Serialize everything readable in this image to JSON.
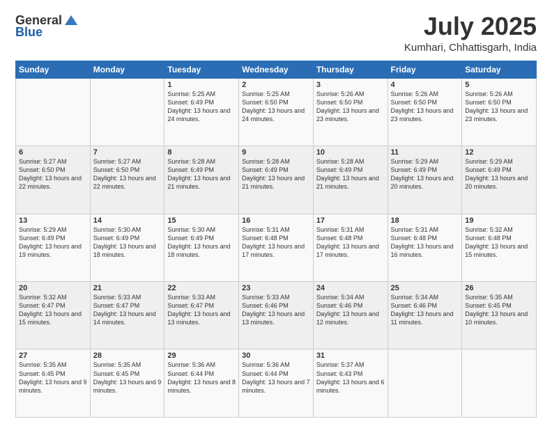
{
  "header": {
    "logo_general": "General",
    "logo_blue": "Blue",
    "month": "July 2025",
    "location": "Kumhari, Chhattisgarh, India"
  },
  "columns": [
    "Sunday",
    "Monday",
    "Tuesday",
    "Wednesday",
    "Thursday",
    "Friday",
    "Saturday"
  ],
  "weeks": [
    [
      {
        "day": "",
        "info": ""
      },
      {
        "day": "",
        "info": ""
      },
      {
        "day": "1",
        "info": "Sunrise: 5:25 AM\nSunset: 6:49 PM\nDaylight: 13 hours and 24 minutes."
      },
      {
        "day": "2",
        "info": "Sunrise: 5:25 AM\nSunset: 6:50 PM\nDaylight: 13 hours and 24 minutes."
      },
      {
        "day": "3",
        "info": "Sunrise: 5:26 AM\nSunset: 6:50 PM\nDaylight: 13 hours and 23 minutes."
      },
      {
        "day": "4",
        "info": "Sunrise: 5:26 AM\nSunset: 6:50 PM\nDaylight: 13 hours and 23 minutes."
      },
      {
        "day": "5",
        "info": "Sunrise: 5:26 AM\nSunset: 6:50 PM\nDaylight: 13 hours and 23 minutes."
      }
    ],
    [
      {
        "day": "6",
        "info": "Sunrise: 5:27 AM\nSunset: 6:50 PM\nDaylight: 13 hours and 22 minutes."
      },
      {
        "day": "7",
        "info": "Sunrise: 5:27 AM\nSunset: 6:50 PM\nDaylight: 13 hours and 22 minutes."
      },
      {
        "day": "8",
        "info": "Sunrise: 5:28 AM\nSunset: 6:49 PM\nDaylight: 13 hours and 21 minutes."
      },
      {
        "day": "9",
        "info": "Sunrise: 5:28 AM\nSunset: 6:49 PM\nDaylight: 13 hours and 21 minutes."
      },
      {
        "day": "10",
        "info": "Sunrise: 5:28 AM\nSunset: 6:49 PM\nDaylight: 13 hours and 21 minutes."
      },
      {
        "day": "11",
        "info": "Sunrise: 5:29 AM\nSunset: 6:49 PM\nDaylight: 13 hours and 20 minutes."
      },
      {
        "day": "12",
        "info": "Sunrise: 5:29 AM\nSunset: 6:49 PM\nDaylight: 13 hours and 20 minutes."
      }
    ],
    [
      {
        "day": "13",
        "info": "Sunrise: 5:29 AM\nSunset: 6:49 PM\nDaylight: 13 hours and 19 minutes."
      },
      {
        "day": "14",
        "info": "Sunrise: 5:30 AM\nSunset: 6:49 PM\nDaylight: 13 hours and 18 minutes."
      },
      {
        "day": "15",
        "info": "Sunrise: 5:30 AM\nSunset: 6:49 PM\nDaylight: 13 hours and 18 minutes."
      },
      {
        "day": "16",
        "info": "Sunrise: 5:31 AM\nSunset: 6:48 PM\nDaylight: 13 hours and 17 minutes."
      },
      {
        "day": "17",
        "info": "Sunrise: 5:31 AM\nSunset: 6:48 PM\nDaylight: 13 hours and 17 minutes."
      },
      {
        "day": "18",
        "info": "Sunrise: 5:31 AM\nSunset: 6:48 PM\nDaylight: 13 hours and 16 minutes."
      },
      {
        "day": "19",
        "info": "Sunrise: 5:32 AM\nSunset: 6:48 PM\nDaylight: 13 hours and 15 minutes."
      }
    ],
    [
      {
        "day": "20",
        "info": "Sunrise: 5:32 AM\nSunset: 6:47 PM\nDaylight: 13 hours and 15 minutes."
      },
      {
        "day": "21",
        "info": "Sunrise: 5:33 AM\nSunset: 6:47 PM\nDaylight: 13 hours and 14 minutes."
      },
      {
        "day": "22",
        "info": "Sunrise: 5:33 AM\nSunset: 6:47 PM\nDaylight: 13 hours and 13 minutes."
      },
      {
        "day": "23",
        "info": "Sunrise: 5:33 AM\nSunset: 6:46 PM\nDaylight: 13 hours and 13 minutes."
      },
      {
        "day": "24",
        "info": "Sunrise: 5:34 AM\nSunset: 6:46 PM\nDaylight: 13 hours and 12 minutes."
      },
      {
        "day": "25",
        "info": "Sunrise: 5:34 AM\nSunset: 6:46 PM\nDaylight: 13 hours and 11 minutes."
      },
      {
        "day": "26",
        "info": "Sunrise: 5:35 AM\nSunset: 6:45 PM\nDaylight: 13 hours and 10 minutes."
      }
    ],
    [
      {
        "day": "27",
        "info": "Sunrise: 5:35 AM\nSunset: 6:45 PM\nDaylight: 13 hours and 9 minutes."
      },
      {
        "day": "28",
        "info": "Sunrise: 5:35 AM\nSunset: 6:45 PM\nDaylight: 13 hours and 9 minutes."
      },
      {
        "day": "29",
        "info": "Sunrise: 5:36 AM\nSunset: 6:44 PM\nDaylight: 13 hours and 8 minutes."
      },
      {
        "day": "30",
        "info": "Sunrise: 5:36 AM\nSunset: 6:44 PM\nDaylight: 13 hours and 7 minutes."
      },
      {
        "day": "31",
        "info": "Sunrise: 5:37 AM\nSunset: 6:43 PM\nDaylight: 13 hours and 6 minutes."
      },
      {
        "day": "",
        "info": ""
      },
      {
        "day": "",
        "info": ""
      }
    ]
  ]
}
